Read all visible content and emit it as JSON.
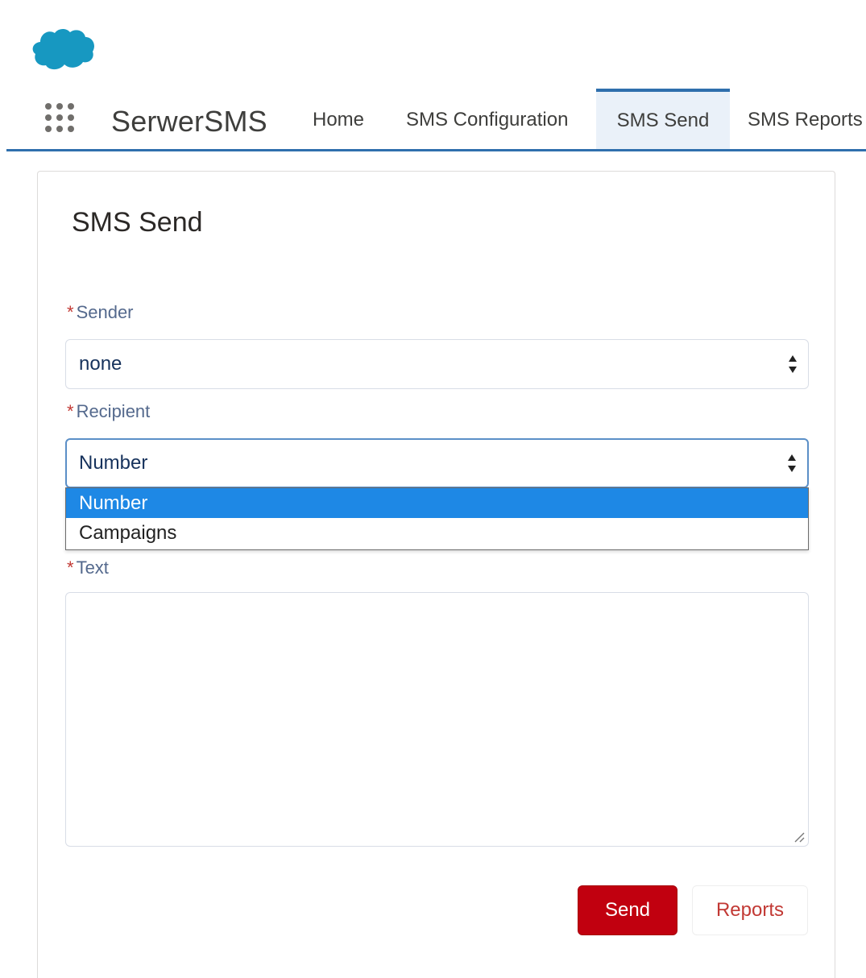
{
  "app": {
    "logo_icon": "salesforce-cloud-icon",
    "launcher_icon": "app-launcher-grid-icon",
    "name": "SerwerSMS"
  },
  "nav": {
    "tabs": [
      {
        "label": "Home",
        "active": false
      },
      {
        "label": "SMS Configuration",
        "active": false
      },
      {
        "label": "SMS Send",
        "active": true
      },
      {
        "label": "SMS Reports",
        "active": false
      }
    ],
    "accent_color": "#2f6fad"
  },
  "form": {
    "title": "SMS Send",
    "required_marker": "*",
    "sender": {
      "label": "Sender",
      "value": "none"
    },
    "recipient": {
      "label": "Recipient",
      "value": "Number",
      "options": [
        {
          "label": "Number",
          "selected": true
        },
        {
          "label": "Campaigns",
          "selected": false
        }
      ]
    },
    "text": {
      "label": "Text",
      "value": ""
    },
    "buttons": {
      "send_label": "Send",
      "reports_label": "Reports"
    },
    "colors": {
      "send_button": "#c1000f",
      "required": "#c23934",
      "selected_option": "#1e88e5"
    }
  }
}
